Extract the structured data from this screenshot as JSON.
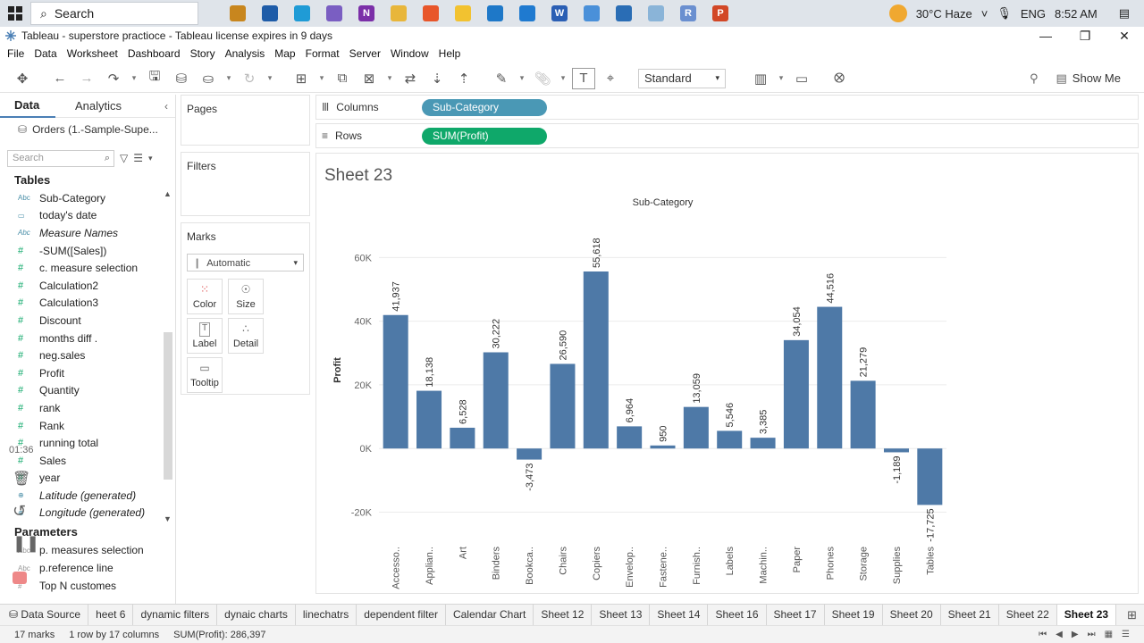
{
  "taskbar": {
    "search_label": "Search",
    "weather": "30°C  Haze",
    "language": "ENG",
    "time": "8:52 AM",
    "apps": [
      {
        "name": "briefcase-app-icon",
        "color": "#c8861e",
        "glyph": ""
      },
      {
        "name": "store-app-icon",
        "color": "#1e5ca8",
        "glyph": ""
      },
      {
        "name": "edge-app-icon",
        "color": "#1f9bd6",
        "glyph": ""
      },
      {
        "name": "chrome-app-icon",
        "color": "#7a5ec2",
        "glyph": ""
      },
      {
        "name": "onenote-app-icon",
        "color": "#7b2fa8",
        "glyph": "N"
      },
      {
        "name": "folder-app-icon",
        "color": "#e8b63b",
        "glyph": ""
      },
      {
        "name": "firefox-app-icon",
        "color": "#e8562a",
        "glyph": ""
      },
      {
        "name": "paint-app-icon",
        "color": "#f2c230",
        "glyph": ""
      },
      {
        "name": "mail-app-icon",
        "color": "#1e78c8",
        "glyph": ""
      },
      {
        "name": "sticky-app-icon",
        "color": "#1f7ad0",
        "glyph": ""
      },
      {
        "name": "word-app-icon",
        "color": "#2b5fb4",
        "glyph": "W"
      },
      {
        "name": "tableau-app-icon",
        "color": "#4a90d9",
        "glyph": ""
      },
      {
        "name": "photos-app-icon",
        "color": "#2a6db5",
        "glyph": ""
      },
      {
        "name": "notepad-app-icon",
        "color": "#8ab4d8",
        "glyph": ""
      },
      {
        "name": "r-app-icon",
        "color": "#6a8fd0",
        "glyph": "R"
      },
      {
        "name": "powerpoint-app-icon",
        "color": "#d24726",
        "glyph": "P"
      }
    ]
  },
  "window": {
    "title": "Tableau - superstore practioce - Tableau license expires in 9 days"
  },
  "menu": [
    "File",
    "Data",
    "Worksheet",
    "Dashboard",
    "Story",
    "Analysis",
    "Map",
    "Format",
    "Server",
    "Window",
    "Help"
  ],
  "toolbar": {
    "fit_value": "Standard",
    "show_me_label": "Show Me"
  },
  "data_pane": {
    "tab_data": "Data",
    "tab_analytics": "Analytics",
    "datasource": "Orders (1.-Sample-Supe...",
    "search_placeholder": "Search",
    "tables_header": "Tables",
    "fields": [
      {
        "type": "Abc",
        "label": "Sub-Category",
        "italic": false
      },
      {
        "type": "▭",
        "label": "today's date",
        "italic": false
      },
      {
        "type": "Abc",
        "label": "Measure Names",
        "italic": true
      },
      {
        "type": "#",
        "label": "-SUM([Sales])",
        "italic": false
      },
      {
        "type": "#",
        "label": "c. measure selection",
        "italic": false
      },
      {
        "type": "#",
        "label": "Calculation2",
        "italic": false
      },
      {
        "type": "#",
        "label": "Calculation3",
        "italic": false
      },
      {
        "type": "#",
        "label": "Discount",
        "italic": false
      },
      {
        "type": "#",
        "label": "months diff .",
        "italic": false
      },
      {
        "type": "#",
        "label": "neg.sales",
        "italic": false
      },
      {
        "type": "#",
        "label": "Profit",
        "italic": false
      },
      {
        "type": "#",
        "label": "Quantity",
        "italic": false
      },
      {
        "type": "#",
        "label": "rank",
        "italic": false
      },
      {
        "type": "#",
        "label": "Rank",
        "italic": false
      },
      {
        "type": "#",
        "label": "running total",
        "italic": false
      },
      {
        "type": "#",
        "label": "Sales",
        "italic": false
      },
      {
        "type": "#",
        "label": "year",
        "italic": false
      },
      {
        "type": "⊕",
        "label": "Latitude (generated)",
        "italic": true
      },
      {
        "type": "⊕",
        "label": "Longitude (generated)",
        "italic": true
      }
    ],
    "parameters_header": "Parameters",
    "parameters": [
      {
        "type": "Abc",
        "label": "p. measures selection"
      },
      {
        "type": "Abc",
        "label": "p.reference line"
      },
      {
        "type": "#",
        "label": "Top N customes"
      }
    ]
  },
  "overlay": {
    "timestamp": "01:36"
  },
  "cards": {
    "pages": "Pages",
    "filters": "Filters",
    "marks": "Marks",
    "marks_type": "Automatic",
    "mark_buttons": [
      "Color",
      "Size",
      "Label",
      "Detail",
      "Tooltip"
    ]
  },
  "shelves": {
    "columns_label": "Columns",
    "columns_pill": "Sub-Category",
    "rows_label": "Rows",
    "rows_pill": "SUM(Profit)"
  },
  "sheet": {
    "title": "Sheet 23"
  },
  "chart_data": {
    "type": "bar",
    "title": "Sub-Category",
    "ylabel": "Profit",
    "xlabel": "",
    "categories": [
      "Accesso..",
      "Applian..",
      "Art",
      "Binders",
      "Bookca..",
      "Chairs",
      "Copiers",
      "Envelop..",
      "Fastene..",
      "Furnish..",
      "Labels",
      "Machin..",
      "Paper",
      "Phones",
      "Storage",
      "Supplies",
      "Tables"
    ],
    "values": [
      41937,
      18138,
      6528,
      30222,
      -3473,
      26590,
      55618,
      6964,
      950,
      13059,
      5546,
      3385,
      34054,
      44516,
      21279,
      -1189,
      -17725
    ],
    "value_labels": [
      "41,937",
      "18,138",
      "6,528",
      "30,222",
      "-3,473",
      "26,590",
      "55,618",
      "6,964",
      "950",
      "13,059",
      "5,546",
      "3,385",
      "34,054",
      "44,516",
      "21,279",
      "-1,189",
      "-17,725"
    ],
    "ylim": [
      -28000,
      66000
    ],
    "yticks": [
      -20000,
      0,
      20000,
      40000,
      60000
    ],
    "ytick_labels": [
      "-20K",
      "0K",
      "20K",
      "40K",
      "60K"
    ],
    "bar_color": "#4e79a7",
    "grid": true
  },
  "sheet_tabs": [
    "Data Source",
    "heet 6",
    "dynamic filters",
    "dynaic charts",
    "linechatrs",
    "dependent filter",
    "Calendar Chart",
    "Sheet 12",
    "Sheet 13",
    "Sheet 14",
    "Sheet 16",
    "Sheet 17",
    "Sheet 19",
    "Sheet 20",
    "Sheet 21",
    "Sheet 22",
    "Sheet 23"
  ],
  "active_sheet": "Sheet 23",
  "status": {
    "marks": "17 marks",
    "dims": "1 row by 17 columns",
    "sum": "SUM(Profit): 286,397"
  }
}
